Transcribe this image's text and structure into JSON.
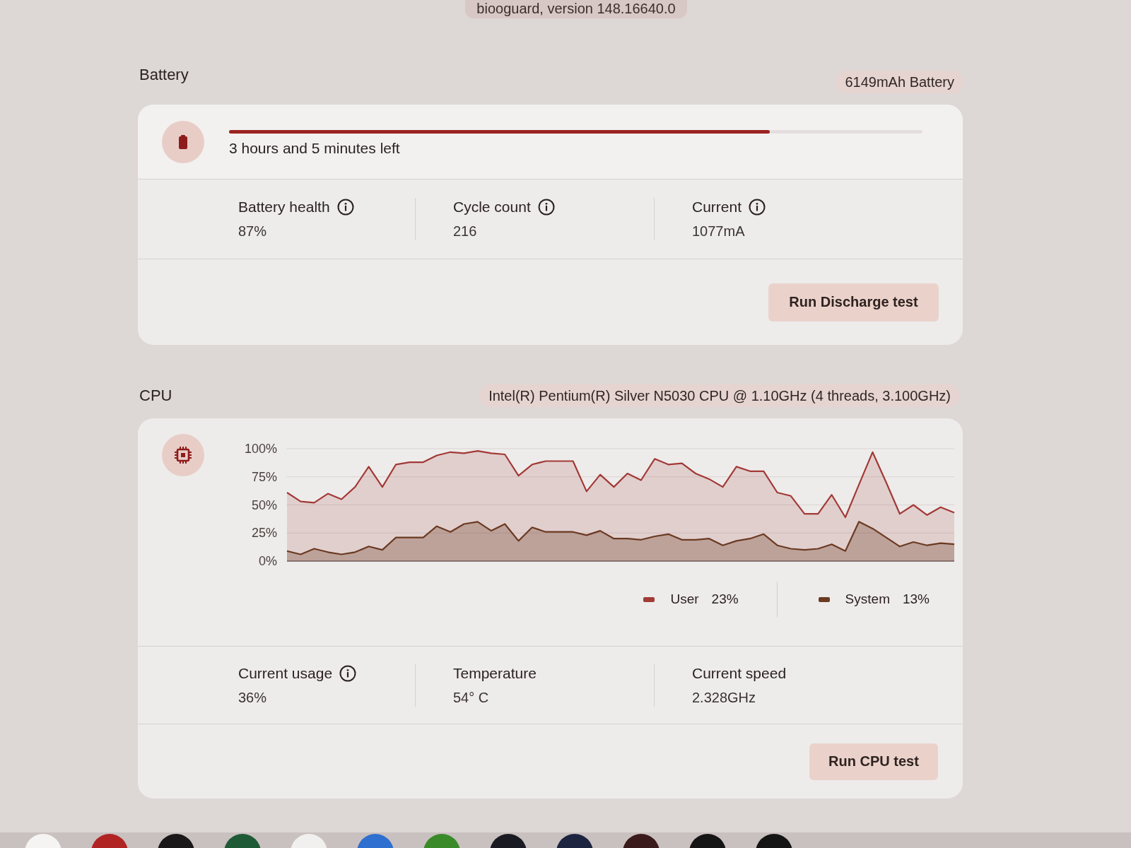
{
  "version_tag": {
    "text": "biooguard, version 148.16640.0"
  },
  "battery": {
    "title": "Battery",
    "capacity": "6149mAh Battery",
    "level": 0.78,
    "time_left": "3 hours and 5 minutes left",
    "metrics": [
      {
        "label": "Battery health",
        "value": "87%",
        "info": true
      },
      {
        "label": "Cycle count",
        "value": "216",
        "info": true
      },
      {
        "label": "Current",
        "value": "1077mA",
        "info": true
      }
    ],
    "button": "Run Discharge test"
  },
  "cpu": {
    "title": "CPU",
    "model": "Intel(R) Pentium(R) Silver N5030 CPU @ 1.10GHz (4 threads, 3.100GHz)",
    "chart_data": [
      {
        "type": "area",
        "categories": [
          null,
          null,
          null,
          null,
          null,
          null,
          null,
          null,
          null,
          null,
          null,
          null,
          null,
          null,
          null,
          null,
          null,
          null,
          null,
          null,
          null,
          null,
          null,
          null,
          null,
          null,
          null,
          null,
          null,
          null,
          null,
          null,
          null,
          null,
          null,
          null,
          null,
          null,
          null,
          null,
          null,
          null,
          null,
          null,
          null,
          null,
          null,
          null,
          null,
          null
        ],
        "ylim": [
          0,
          100
        ],
        "yticks": [
          {
            "value": 0,
            "label": "0%"
          },
          {
            "value": 25,
            "label": "25%"
          },
          {
            "value": 50,
            "label": "50%"
          },
          {
            "value": 75,
            "label": "75%"
          },
          {
            "value": 100,
            "label": "100%"
          }
        ],
        "grid": true,
        "tick_labels": "y",
        "legend": "bottom",
        "series": [
          {
            "name": "User",
            "color": "#a23a36",
            "values": [
              61,
              53,
              52,
              60,
              55,
              66,
              84,
              66,
              86,
              88,
              88,
              94,
              97,
              96,
              98,
              96,
              95,
              76,
              86,
              89,
              89,
              89,
              62,
              77,
              66,
              78,
              72,
              91,
              86,
              87,
              78,
              73,
              66,
              84,
              80,
              80,
              61,
              58,
              42,
              42,
              59,
              39,
              68,
              97,
              70,
              42,
              50,
              41,
              48,
              43
            ]
          },
          {
            "name": "System",
            "color": "#6b3a22",
            "values": [
              9,
              6,
              11,
              8,
              6,
              8,
              13,
              10,
              21,
              21,
              21,
              31,
              26,
              33,
              35,
              27,
              33,
              18,
              30,
              26,
              26,
              26,
              23,
              27,
              20,
              20,
              19,
              22,
              24,
              19,
              19,
              20,
              14,
              18,
              20,
              24,
              14,
              11,
              10,
              11,
              15,
              9,
              35,
              29,
              21,
              13,
              17,
              14,
              16,
              15
            ]
          }
        ]
      }
    ],
    "legend_readings": [
      "23%",
      "13%"
    ],
    "metrics": [
      {
        "label": "Current usage",
        "value": "36%",
        "info": true
      },
      {
        "label": "Temperature",
        "value": "54° C",
        "info": false
      },
      {
        "label": "Current speed",
        "value": "2.328GHz",
        "info": false
      }
    ],
    "button": "Run CPU test"
  },
  "shelf": {
    "apps": [
      {
        "color": "#f6f4f3"
      },
      {
        "color": "#b02424"
      },
      {
        "color": "#1a1818"
      },
      {
        "color": "#1f5a36"
      },
      {
        "color": "#f2f0ef"
      },
      {
        "color": "#2f6fd0"
      },
      {
        "color": "#3a8a2a"
      },
      {
        "color": "#1a1a22"
      },
      {
        "color": "#1c2440"
      },
      {
        "color": "#3a1a1a"
      },
      {
        "color": "#161515"
      },
      {
        "color": "#161515"
      }
    ]
  }
}
